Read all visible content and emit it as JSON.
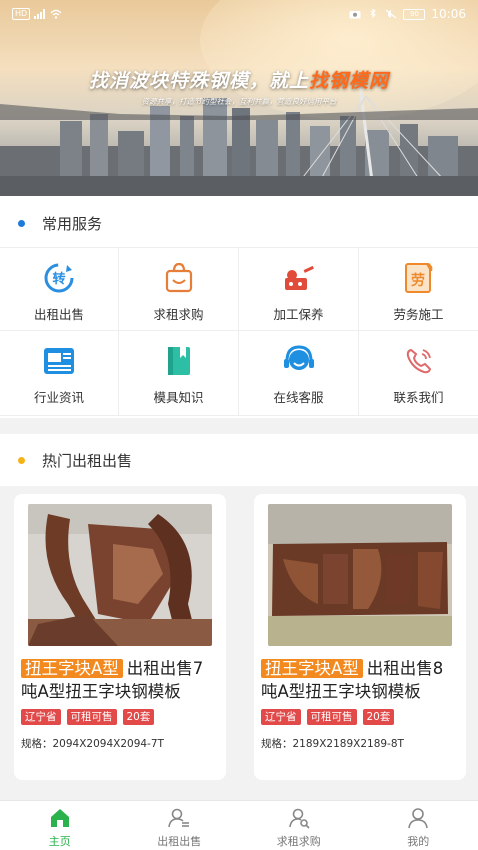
{
  "status_bar": {
    "left_chip": "HD",
    "time": "10:06",
    "battery": "90"
  },
  "banner": {
    "headline_main": "找消波块特殊钢模，就上",
    "headline_highlight": "找钢模网",
    "subline": "资源共享，打造节约型社会，互利共赢，营造良好信用平台"
  },
  "services": {
    "title": "常用服务",
    "dot_color": "#1e7bd8",
    "items": [
      {
        "label": "出租出售",
        "icon": "transfer-icon"
      },
      {
        "label": "求租求购",
        "icon": "shopping-bag-icon"
      },
      {
        "label": "加工保养",
        "icon": "machine-icon"
      },
      {
        "label": "劳务施工",
        "icon": "labor-icon"
      },
      {
        "label": "行业资讯",
        "icon": "newspaper-icon"
      },
      {
        "label": "模具知识",
        "icon": "book-icon"
      },
      {
        "label": "在线客服",
        "icon": "headset-icon"
      },
      {
        "label": "联系我们",
        "icon": "phone-icon"
      }
    ]
  },
  "hot": {
    "title": "热门出租出售",
    "dot_color": "#f4b31b",
    "cards": [
      {
        "type": "扭王字块A型",
        "title": "出租出售7吨A型扭王字块钢模板",
        "tags": [
          "辽宁省",
          "可租可售",
          "20套"
        ],
        "spec_label": "规格：",
        "spec_value": "2094X2094X2094-7T"
      },
      {
        "type": "扭王字块A型",
        "title": "出租出售8吨A型扭王字块钢模板",
        "tags": [
          "辽宁省",
          "可租可售",
          "20套"
        ],
        "spec_label": "规格：",
        "spec_value": "2189X2189X2189-8T"
      }
    ]
  },
  "tabbar": {
    "active_color": "#2bb24c",
    "items": [
      {
        "label": "主页",
        "icon": "home-icon",
        "active": true
      },
      {
        "label": "出租出售",
        "icon": "user-list-icon",
        "active": false
      },
      {
        "label": "求租求购",
        "icon": "user-search-icon",
        "active": false
      },
      {
        "label": "我的",
        "icon": "user-icon",
        "active": false
      }
    ]
  }
}
